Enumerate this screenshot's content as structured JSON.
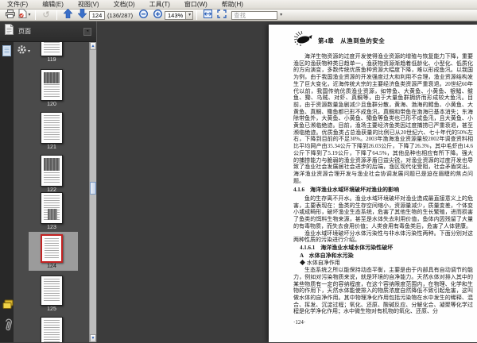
{
  "menubar": {
    "items": [
      "文件(F)",
      "编辑(E)",
      "视图(V)",
      "文档(D)",
      "工具(T)",
      "窗口(W)",
      "帮助(H)"
    ]
  },
  "toolbar": {
    "page_value": "124",
    "page_count": "(136/287)",
    "zoom_value": "143%",
    "search_placeholder": "查找"
  },
  "icons": {
    "caret": "▾",
    "rotate_glyph": "↺",
    "scroll_up": "▲",
    "scroll_down": "▼",
    "panel_btn_glyph": "◂"
  },
  "sidebar": {
    "panel_title": "页面",
    "thumbnails": [
      {
        "label": "119"
      },
      {
        "label": "120"
      },
      {
        "label": "121"
      },
      {
        "label": "122"
      },
      {
        "label": "123"
      },
      {
        "label": "124",
        "selected": true
      },
      {
        "label": "125"
      },
      {
        "label": ""
      }
    ]
  },
  "doc": {
    "chapter_header": "第4章　从渔到鱼的安全",
    "paragraphs": [
      {
        "type": "para",
        "text": "海洋生物资源的过度开发使得渔业资源的增殖与恢复能力下降，重要渔区的渔获物种类日趋单一，渔获物资源渐趋着低龄化、小型化、低质化的方向演变，多数传统优质鱼种资源大幅度下降，难以形成鱼汛。以我国为例，由于我国渔业资源的开发强度过大和利用不合理，渔业资源结构发生了巨大变化，近海传统大宗的主要经济鱼类资源严重衰退。20世纪60年代以前，我国传统优质渔业资源，如带鱼、大黄鱼、小黄鱼、银鲳、鲅鱼、鳓、乌贼、对虾、真鲷等，由于大量鱼群拥挤而形成较大鱼汛。目前，由于资源数量急剧减少且鱼群分散，黄海、渤海的鳕鱼、小黄鱼、大黄鱼、真鲷、鳓鱼都已形不成鱼汛，真鲷和带鱼在渤海已基本消失；东海除带鱼外，大黄鱼、小黄鱼、鳓鱼等鱼类也已形不成鱼汛，且大黄鱼、小黄鱼已濒临绝迹。目前，渔场主要经济鱼类因过度捕捞已严重衰退，甚至濒临绝迹。优质鱼类占总渔获量的比例已从20世纪六、七十年代的50%左右，下降到目前的不足30%。2003年渤海渔业资源量较2002年调查资料相比平均网产由35.34公斤下降到26.03公斤，下降了26.3%，其中毛虾由14.6公斤下降到了5.19公斤，下降了64.5%，其他品种也相应有所下降。强大的捕捞能力与脆弱的渔业资源矛盾日益尖锐，对渔业资源的过度开发也导致了渔业社会发展居社会进步的后端，渔区现代化受阻，社会矛盾突出。海洋渔业资源合理开发与渔业社会协调发展问题已是迫在眉睫的焦点问题。"
      },
      {
        "type": "heading",
        "text": "4.1.6　海洋渔业水域环境破坏对渔业的影响"
      },
      {
        "type": "para",
        "text": "鱼的生存离不开水。渔业水域环境破坏对渔业造成最直接意义上的危害，主要表现在：鱼类的生存空间缩小，资源量减少，质量变差，个体变小或成畸形，破坏渔业生态系统，危害了其他生物的生长繁殖，进而损害了鱼类的饵料生物来源，甚至是水体失去利用价值，鱼体内因残留了大量的有毒物质，而失去食用价值；人类食用有毒鱼类后，危害了人体健康。"
      },
      {
        "type": "para",
        "text": "渔业水域环境破坏分水体污染性与非水体污染性两种。下面分别对这两种性质的污染进行介绍。"
      },
      {
        "type": "heading2",
        "text": "4.1.6.1　海洋渔业水域水体污染性破坏"
      },
      {
        "type": "heading3",
        "text": "A　水体自净和水污染"
      },
      {
        "type": "bullet",
        "text": "◆ 水体自净作用"
      },
      {
        "type": "para",
        "text": "生态系统之所以能保持动态平衡，主要是由于内部具有自动调节的能力，例如对污染物质来说，就是环境的自净能力。天然水体对排入其中的某些物质有一定的容纳程度，在这个容纳限度范围内，在物理、化学和生物的作用下，天然水体能使排入的物质浓度自然降低不致引起危害，这叫做水体的自净作用。其中物理净化作用包括污染物在水中发生的稀释、混合、挥发、沉淀过程；氧化、还原、酸碱反应、分解化合、凝聚等化学过程是化学净化作用；水中微生物对有机物的氧化、还原、分"
      }
    ],
    "footer": "·124·"
  }
}
